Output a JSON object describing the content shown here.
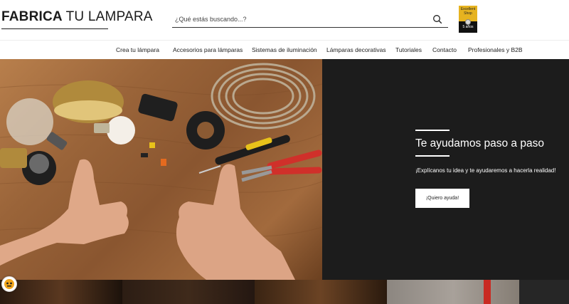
{
  "header": {
    "logo": {
      "part1": "FABRICA ",
      "part2": "TU LAMPARA"
    },
    "search": {
      "placeholder": "¿Qué estás buscando...?"
    },
    "badge": {
      "line1": "Excellent",
      "line2": "Shop",
      "line3": "5 años"
    }
  },
  "nav": {
    "items": [
      {
        "label": "Crea tu lámpara"
      },
      {
        "label": "Accesorios para lámparas"
      },
      {
        "label": "Sistemas de iluminación"
      },
      {
        "label": "Lámparas decorativas"
      },
      {
        "label": "Tutoriales"
      },
      {
        "label": "Contacto"
      },
      {
        "label": "Profesionales y B2B"
      }
    ]
  },
  "hero": {
    "title": "Te ayudamos paso a paso",
    "subtitle": "¡Explícanos tu idea y te ayudaremos a hacerla realidad!",
    "button": "¡Quiero ayuda!"
  },
  "colors": {
    "hero_panel": "#1c1c1c",
    "badge_gold": "#e6b320"
  }
}
